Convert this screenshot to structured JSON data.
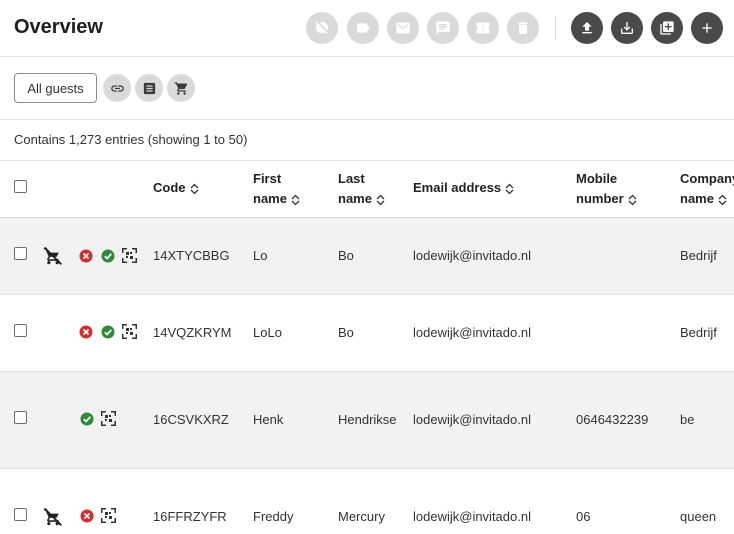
{
  "page": {
    "title": "Overview"
  },
  "header_actions": [
    {
      "name": "hide-icon",
      "label": "Hide"
    },
    {
      "name": "tag-icon",
      "label": "Tag"
    },
    {
      "name": "mail-icon",
      "label": "Send email"
    },
    {
      "name": "chat-icon",
      "label": "Send message"
    },
    {
      "name": "ticket-icon",
      "label": "Tickets"
    },
    {
      "name": "trash-icon",
      "label": "Delete"
    },
    {
      "name": "upload-icon",
      "label": "Upload"
    },
    {
      "name": "download-icon",
      "label": "Download"
    },
    {
      "name": "duplicate-icon",
      "label": "Duplicate"
    },
    {
      "name": "plus-icon",
      "label": "Add"
    }
  ],
  "filter": {
    "all_guests_label": "All guests",
    "icons": [
      "link-icon",
      "list-icon",
      "cart-icon"
    ]
  },
  "summary": "Contains 1,273 entries (showing 1 to 50)",
  "table": {
    "columns": [
      {
        "key": "code",
        "label": "Code"
      },
      {
        "key": "first_name",
        "label": "First name"
      },
      {
        "key": "last_name",
        "label": "Last name"
      },
      {
        "key": "email",
        "label": "Email address"
      },
      {
        "key": "mobile",
        "label": "Mobile number"
      },
      {
        "key": "company",
        "label": "Company name"
      }
    ],
    "rows": [
      {
        "code": "14XTYCBBG",
        "first_name": "Lo",
        "last_name": "Bo",
        "email": "lodewijk@invitado.nl",
        "mobile": "",
        "company": "Bedrijf",
        "status_icons": [
          "cart-off-icon",
          "declined-icon",
          "confirmed-icon",
          "qr-code-icon"
        ]
      },
      {
        "code": "14VQZKRYM",
        "first_name": "LoLo",
        "last_name": "Bo",
        "email": "lodewijk@invitado.nl",
        "mobile": "",
        "company": "Bedrijf",
        "status_icons": [
          "declined-icon",
          "confirmed-icon",
          "qr-code-icon"
        ]
      },
      {
        "code": "16CSVKXRZ",
        "first_name": "Henk",
        "last_name": "Hendrikse",
        "email": "lodewijk@invitado.nl",
        "mobile": "0646432239",
        "company": "be",
        "status_icons": [
          "confirmed-icon",
          "qr-code-icon"
        ]
      },
      {
        "code": "16FFRZYFR",
        "first_name": "Freddy",
        "last_name": "Mercury",
        "email": "lodewijk@invitado.nl",
        "mobile": "06",
        "company": "queen",
        "status_icons": [
          "cart-off-icon",
          "declined-icon",
          "qr-code-icon"
        ]
      }
    ]
  },
  "colors": {
    "accent_dark": "#4a4a4a",
    "disabled": "#dadada",
    "declined": "#d32f2f",
    "confirmed": "#2e8b3a",
    "row_shade": "#f2f2f2"
  }
}
